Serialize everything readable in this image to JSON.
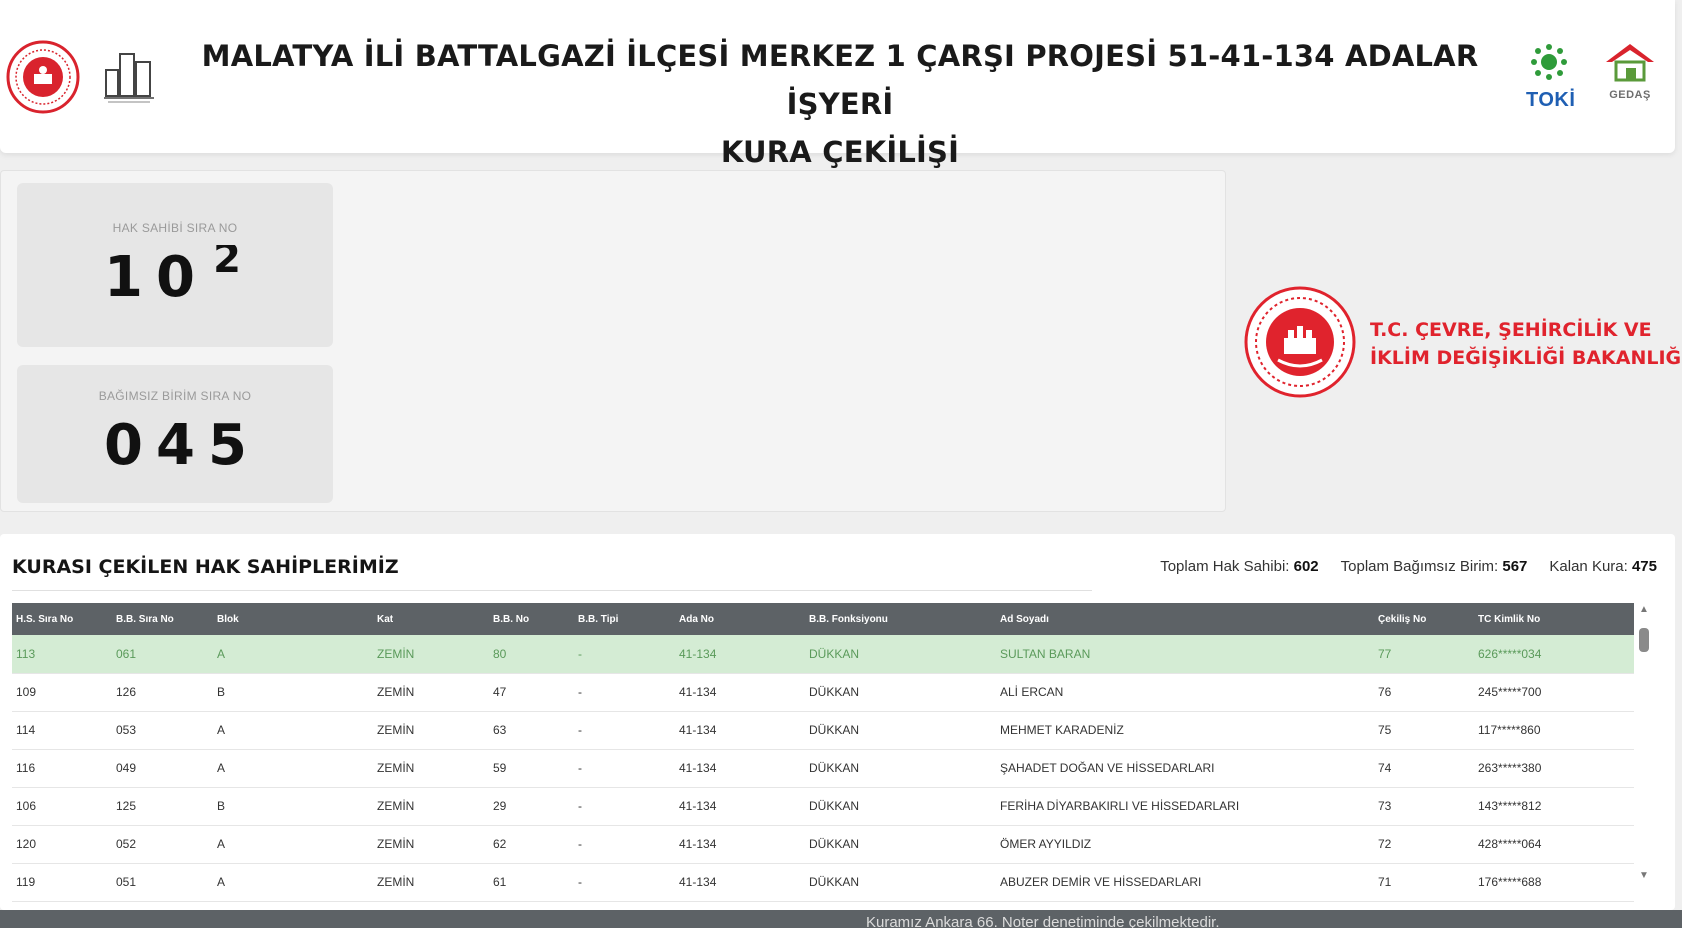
{
  "header": {
    "title_line1": "MALATYA İLİ BATTALGAZİ İLÇESİ MERKEZ 1 ÇARŞI PROJESİ 51-41-134 ADALAR İŞYERİ",
    "title_line2": "KURA ÇEKİLİŞİ",
    "logo_toki": "TOKİ",
    "logo_gedas": "GEDAŞ"
  },
  "counters": {
    "hak_sahibi_label": "HAK SAHİBİ SIRA NO",
    "hak_sahibi_digits": [
      "1",
      "0",
      "2"
    ],
    "bagimsiz_label": "BAĞIMSIZ BİRİM SIRA NO",
    "bagimsiz_digits": [
      "0",
      "4",
      "5"
    ]
  },
  "ministry": {
    "line1": "T.C. ÇEVRE, ŞEHİRCİLİK VE",
    "line2": "İKLİM DEĞİŞİKLİĞİ BAKANLIĞI"
  },
  "results": {
    "title": "KURASI ÇEKİLEN HAK SAHİPLERİMİZ",
    "stats": {
      "toplam_hak_label": "Toplam Hak Sahibi:",
      "toplam_hak_value": "602",
      "toplam_birim_label": "Toplam Bağımsız Birim:",
      "toplam_birim_value": "567",
      "kalan_label": "Kalan Kura:",
      "kalan_value": "475"
    },
    "columns": [
      "H.S. Sıra No",
      "B.B. Sıra No",
      "Blok",
      "Kat",
      "B.B. No",
      "B.B. Tipi",
      "Ada No",
      "B.B. Fonksiyonu",
      "Ad Soyadı",
      "Çekiliş No",
      "TC Kimlik No"
    ],
    "rows": [
      [
        "113",
        "061",
        "A",
        "ZEMİN",
        "80",
        "-",
        "41-134",
        "DÜKKAN",
        "SULTAN BARAN",
        "77",
        "626*****034"
      ],
      [
        "109",
        "126",
        "B",
        "ZEMİN",
        "47",
        "-",
        "41-134",
        "DÜKKAN",
        "ALİ ERCAN",
        "76",
        "245*****700"
      ],
      [
        "114",
        "053",
        "A",
        "ZEMİN",
        "63",
        "-",
        "41-134",
        "DÜKKAN",
        "MEHMET KARADENİZ",
        "75",
        "117*****860"
      ],
      [
        "116",
        "049",
        "A",
        "ZEMİN",
        "59",
        "-",
        "41-134",
        "DÜKKAN",
        "ŞAHADET DOĞAN VE HİSSEDARLARI",
        "74",
        "263*****380"
      ],
      [
        "106",
        "125",
        "B",
        "ZEMİN",
        "29",
        "-",
        "41-134",
        "DÜKKAN",
        "FERİHA DİYARBAKIRLI VE HİSSEDARLARI",
        "73",
        "143*****812"
      ],
      [
        "120",
        "052",
        "A",
        "ZEMİN",
        "62",
        "-",
        "41-134",
        "DÜKKAN",
        "ÖMER AYYILDIZ",
        "72",
        "428*****064"
      ],
      [
        "119",
        "051",
        "A",
        "ZEMİN",
        "61",
        "-",
        "41-134",
        "DÜKKAN",
        "ABUZER DEMİR VE HİSSEDARLARI",
        "71",
        "176*****688"
      ]
    ]
  },
  "footer": {
    "text": "Kuramız Ankara 66. Noter denetiminde çekilmektedir."
  },
  "colors": {
    "highlight_row": "#d4ecd4",
    "table_header": "#5d6266",
    "ministry_red": "#e0232d"
  }
}
